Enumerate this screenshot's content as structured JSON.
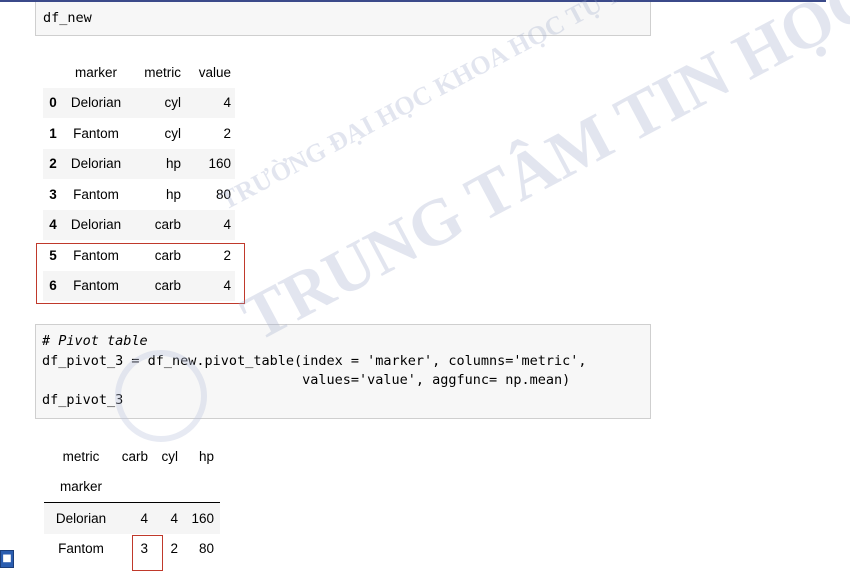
{
  "cell1": {
    "code": "df_new"
  },
  "table1": {
    "headers": [
      "marker",
      "metric",
      "value"
    ],
    "rows": [
      {
        "index": "0",
        "marker": "Delorian",
        "metric": "cyl",
        "value": "4"
      },
      {
        "index": "1",
        "marker": "Fantom",
        "metric": "cyl",
        "value": "2"
      },
      {
        "index": "2",
        "marker": "Delorian",
        "metric": "hp",
        "value": "160"
      },
      {
        "index": "3",
        "marker": "Fantom",
        "metric": "hp",
        "value": "80"
      },
      {
        "index": "4",
        "marker": "Delorian",
        "metric": "carb",
        "value": "4"
      },
      {
        "index": "5",
        "marker": "Fantom",
        "metric": "carb",
        "value": "2"
      },
      {
        "index": "6",
        "marker": "Fantom",
        "metric": "carb",
        "value": "4"
      }
    ]
  },
  "cell2": {
    "line1": "# Pivot table",
    "line2": "df_pivot_3 = df_new.pivot_table(index = 'marker', columns='metric',",
    "line3": "                                values='value', aggfunc= np.mean)",
    "line4": "df_pivot_3"
  },
  "table2": {
    "columns_name": "metric",
    "index_name": "marker",
    "headers": [
      "carb",
      "cyl",
      "hp"
    ],
    "rows": [
      {
        "index": "Delorian",
        "carb": "4",
        "cyl": "4",
        "hp": "160"
      },
      {
        "index": "Fantom",
        "carb": "3",
        "cyl": "2",
        "hp": "80"
      }
    ]
  },
  "watermark": {
    "line1": "TRƯỜNG ĐẠI HỌC KHOA HỌC TỰ NHIÊN",
    "line2": "TRUNG TÂM TIN HỌC"
  },
  "colors": {
    "highlight": "#c0392b",
    "cell_bg": "#f7f7f7",
    "topline": "#3b4a8a"
  },
  "icons": {
    "corner": "taskbar-app-icon"
  }
}
